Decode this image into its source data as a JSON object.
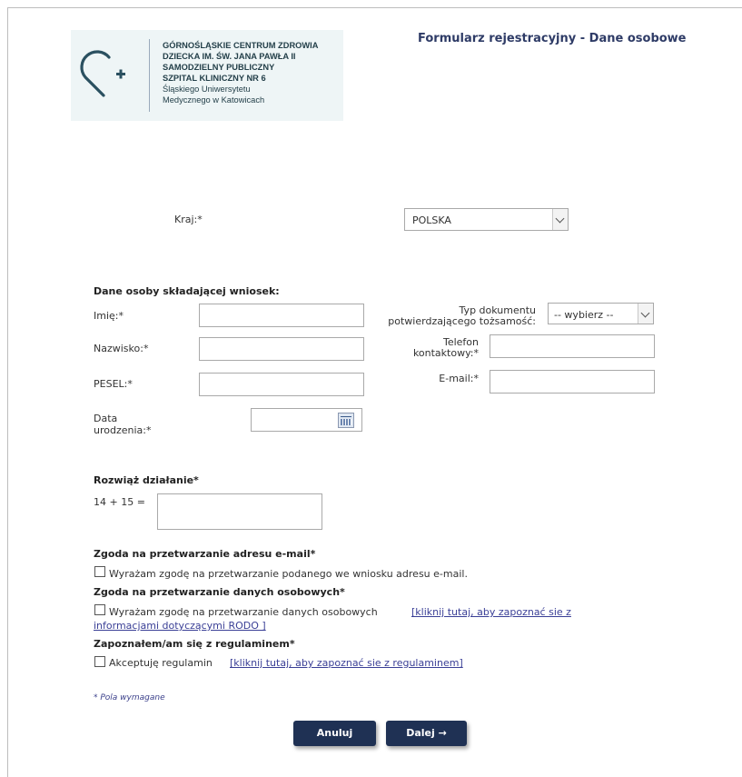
{
  "header": {
    "logo_lines": [
      "GÓRNOŚLĄSKIE CENTRUM ZDROWIA",
      "DZIECKA IM. ŚW. JANA PAWŁA II",
      "SAMODZIELNY PUBLICZNY",
      "SZPITAL KLINICZNY NR 6",
      "Śląskiego Uniwersytetu",
      "Medycznego w Katowicach"
    ],
    "title": "Formularz rejestracyjny - Dane osobowe"
  },
  "country": {
    "label": "Kraj:*",
    "value": "POLSKA"
  },
  "applicant": {
    "section_title": "Dane osoby składającej wniosek:",
    "first_name_label": "Imię:*",
    "last_name_label": "Nazwisko:*",
    "pesel_label": "PESEL:*",
    "birth_date_label_1": "Data",
    "birth_date_label_2": "urodzenia:*",
    "doc_type_label_1": "Typ dokumentu",
    "doc_type_label_2": "potwierdzającego tożsamość:",
    "doc_type_value": "-- wybierz --",
    "phone_label_1": "Telefon",
    "phone_label_2": "kontaktowy:*",
    "email_label": "E-mail:*"
  },
  "captcha": {
    "section_title": "Rozwiąż działanie*",
    "question": "14 + 15 ="
  },
  "consents": {
    "email_title": "Zgoda na przetwarzanie adresu e-mail*",
    "email_text": "Wyrażam zgodę na przetwarzanie podanego we wniosku adresu e-mail.",
    "data_title": "Zgoda na przetwarzanie danych osobowych*",
    "data_text": "Wyrażam zgodę na przetwarzanie danych osobowych",
    "data_link_1": "[kliknij tutaj, aby zapoznać sie z",
    "data_link_2": "informacjami dotyczącymi RODO ]",
    "rules_title": "Zapoznałem/am się z regulaminem*",
    "rules_text": "Akceptuję regulamin",
    "rules_link": "[kliknij tutaj, aby zapoznać sie z regulaminem]"
  },
  "required_note": "* Pola wymagane",
  "buttons": {
    "cancel": "Anuluj",
    "next": "Dalej →"
  },
  "colors": {
    "title": "#2e3b66",
    "button": "#1f3154",
    "link": "#3a3f96"
  }
}
